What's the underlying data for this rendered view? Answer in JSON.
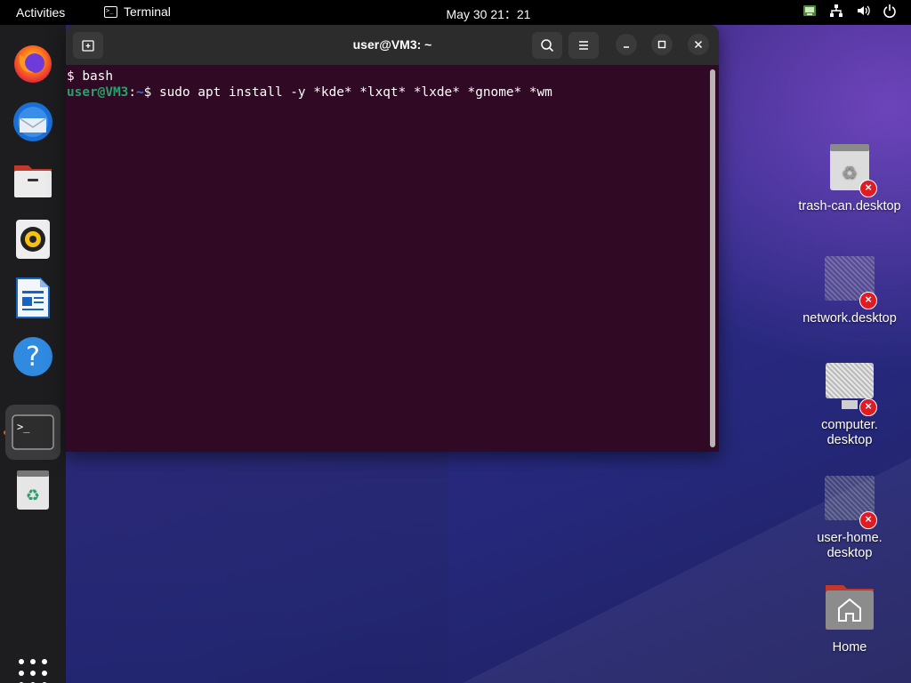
{
  "topbar": {
    "activities": "Activities",
    "app_name": "Terminal",
    "clock": "May 30  21：21",
    "tray_icons": [
      "app-indicator-icon",
      "network-icon",
      "volume-icon",
      "power-icon"
    ]
  },
  "dock": {
    "items": [
      {
        "name": "firefox-icon"
      },
      {
        "name": "thunderbird-icon"
      },
      {
        "name": "files-icon"
      },
      {
        "name": "rhythmbox-icon"
      },
      {
        "name": "libreoffice-writer-icon"
      },
      {
        "name": "help-icon"
      },
      {
        "name": "terminal-icon",
        "active": true
      },
      {
        "name": "trash-icon"
      }
    ],
    "apps_grid": "show-apps-icon"
  },
  "terminal": {
    "title": "user@VM3: ~",
    "lines": [
      {
        "text": "$ bash"
      },
      {
        "user": "user@VM3",
        "sep": ":",
        "path": "~",
        "prompt": "$ ",
        "command": "sudo apt install -y *kde* *lxqt* *lxde* *gnome* *wm"
      }
    ]
  },
  "desktop": {
    "icons": [
      {
        "label": "trash-can.desktop"
      },
      {
        "label": "network.desktop"
      },
      {
        "label_line1": "computer.",
        "label_line2": "desktop"
      },
      {
        "label_line1": "user-home.",
        "label_line2": "desktop"
      },
      {
        "label": "Home"
      }
    ]
  },
  "colors": {
    "terminal_bg": "#300a24",
    "headerbar_bg": "#2c2c2c",
    "prompt_user": "#26a269",
    "prompt_path": "#2a7bde",
    "accent": "#e95420",
    "error_badge": "#e01b24"
  }
}
